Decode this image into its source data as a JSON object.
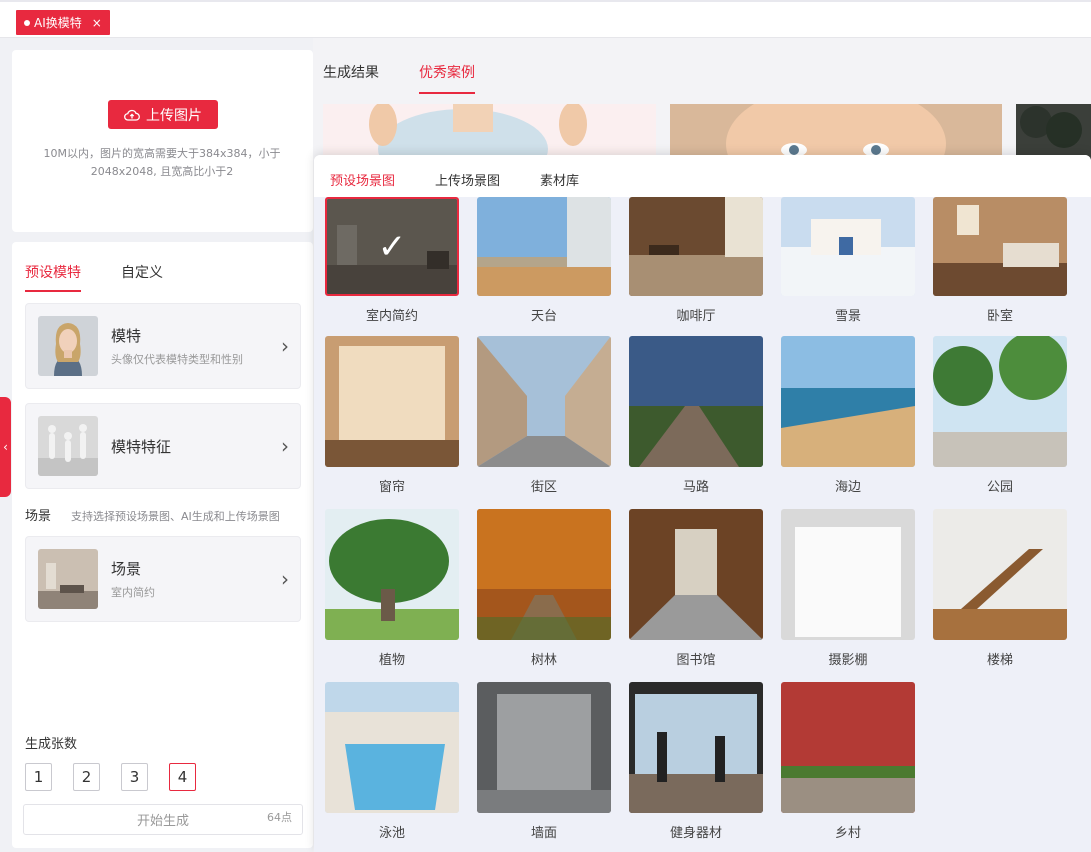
{
  "app_tab": {
    "label": "AI换模特",
    "close": "×"
  },
  "upload": {
    "button_label": "上传图片",
    "hint": "10M以内，图片的宽高需要大于384x384，小于2048x2048, 且宽高比小于2"
  },
  "config": {
    "tabs": [
      {
        "label": "预设模特",
        "active": true
      },
      {
        "label": "自定义",
        "active": false
      }
    ],
    "model": {
      "title": "模特",
      "subtitle": "头像仅代表模特类型和性别"
    },
    "model_feature": {
      "title": "模特特征"
    },
    "scene_section": {
      "label": "场景",
      "note": "支持选择预设场景图、AI生成和上传场景图"
    },
    "scene": {
      "title": "场景",
      "subtitle": "室内简约"
    },
    "count_label": "生成张数",
    "counts": [
      "1",
      "2",
      "3",
      "4"
    ],
    "count_selected": "4",
    "generate": {
      "label": "开始生成",
      "cost": "64点"
    }
  },
  "main": {
    "tabs": [
      {
        "label": "生成结果",
        "active": false
      },
      {
        "label": "优秀案例",
        "active": true
      }
    ]
  },
  "popup": {
    "tabs": [
      {
        "label": "预设场景图",
        "active": true
      },
      {
        "label": "上传场景图",
        "active": false
      },
      {
        "label": "素材库",
        "active": false
      }
    ],
    "selected": "室内简约",
    "scenes": [
      "室内简约",
      "天台",
      "咖啡厅",
      "雪景",
      "卧室",
      "窗帘",
      "街区",
      "马路",
      "海边",
      "公园",
      "植物",
      "树林",
      "图书馆",
      "摄影棚",
      "楼梯",
      "泳池",
      "墙面",
      "健身器材",
      "乡村"
    ]
  },
  "colors": {
    "accent": "#e8293f",
    "panel": "#eef0f8"
  }
}
